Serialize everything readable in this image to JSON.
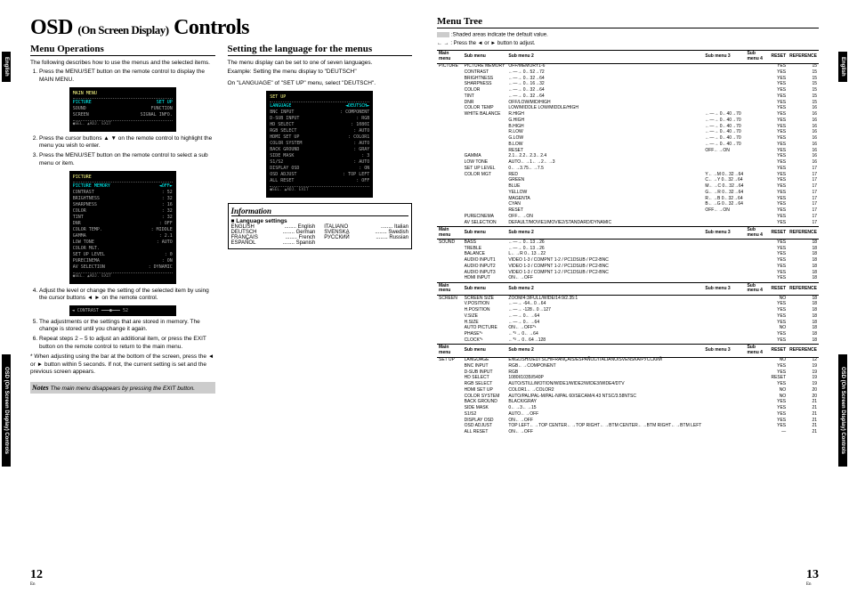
{
  "title": {
    "main": "OSD",
    "mid": "(On Screen Display)",
    "end": "Controls"
  },
  "tabs": {
    "english": "English",
    "osd": "OSD (On Screen Display) Controls"
  },
  "left": {
    "h_menuops": "Menu Operations",
    "intro": "The following describes how to use the menus and the selected items.",
    "step1": "Press the MENU/SET button on the remote control to display the MAIN MENU.",
    "osd1_title": "MAIN MENU",
    "osd1_items": [
      [
        "PICTURE",
        "SET UP"
      ],
      [
        "SOUND",
        "FUNCTION"
      ],
      [
        "SCREEN",
        "SIGNAL INFO."
      ]
    ],
    "step2": "Press the cursor buttons ▲ ▼ on the remote control to highlight the menu you wish to enter.",
    "step3": "Press the MENU/SET button on the remote control to select a sub menu or item.",
    "osd2_title": "PICTURE",
    "osd2_items": [
      [
        "PICTURE MEMORY",
        "◄OFF►"
      ],
      [
        "CONTRAST",
        ": 52"
      ],
      [
        "BRIGHTNESS",
        ": 32"
      ],
      [
        "SHARPNESS",
        ": 16"
      ],
      [
        "COLOR",
        ": 32"
      ],
      [
        "TINT",
        ": 32"
      ],
      [
        "DNR",
        ": OFF"
      ],
      [
        "COLOR TEMP.",
        ": MIDDLE"
      ],
      [
        "GAMMA",
        ": 2.1"
      ],
      [
        "LOW TONE",
        ": AUTO"
      ],
      [
        "COLOR MGT.",
        ""
      ],
      [
        "SET UP LEVEL",
        ": 0"
      ],
      [
        "PURECINEMA",
        ": ON"
      ],
      [
        "AV SELECTION",
        ": DYNAMIC"
      ]
    ],
    "step4": "Adjust the level or change the setting of the selected item by using the cursor buttons ◄ ► on the remote control.",
    "slider": "◄ CONTRAST ━━━●━━━ 52",
    "step5": "The adjustments or the settings that are stored in memory. The change is stored until you change it again.",
    "step6": "Repeat steps 2 – 5 to adjust an additional item, or press the EXIT button on the remote control to return to the main menu.",
    "note_ast": "When adjusting using the bar at the bottom of the screen, press the ◄ or ► button within 5 seconds. If not, the current setting is set and the previous screen appears.",
    "notes_label": "Notes",
    "notes_text": "The main menu disappears by pressing the EXIT button."
  },
  "mid": {
    "h_lang": "Setting the language for the menus",
    "p1": "The menu display can be set to one of seven languages.",
    "p2": "Example: Setting the menu display to \"DEUTSCH\"",
    "p3": "On \"LANGUAGE\" of \"SET UP\" menu, select \"DEUTSCH\".",
    "osd3_title": "SET UP",
    "osd3_items": [
      [
        "LANGUAGE",
        "◄DEUTSCH►"
      ],
      [
        "BNC INPUT",
        ": COMPONENT"
      ],
      [
        "D-SUB INPUT",
        ": RGB"
      ],
      [
        "HD SELECT",
        ": 1080I"
      ],
      [
        "RGB SELECT",
        ": AUTO"
      ],
      [
        "HDMI SET UP",
        ": COLOR1"
      ],
      [
        "COLOR SYSTEM",
        ": AUTO"
      ],
      [
        "BACK GROUND",
        ": GRAY"
      ],
      [
        "SIDE MASK",
        ": 3"
      ],
      [
        "S1/S2",
        ": AUTO"
      ],
      [
        "DISPLAY OSD",
        ": ON"
      ],
      [
        "OSD ADJUST",
        ": TOP LEFT"
      ],
      [
        "ALL RESET",
        ": OFF"
      ]
    ],
    "info_h": "Information",
    "info_sub": "■ Language settings",
    "langs": [
      [
        "ENGLISH",
        "English"
      ],
      [
        "DEUTSCH",
        "German"
      ],
      [
        "FRANÇAIS",
        "French"
      ],
      [
        "ESPAÑOL",
        "Spanish"
      ],
      [
        "ITALIANO",
        "Italian"
      ],
      [
        "SVENSKA",
        "Swedish"
      ],
      [
        "РУССКИЙ",
        "Russian"
      ]
    ]
  },
  "right": {
    "h_tree": "Menu Tree",
    "note1": ":Shaded areas indicate the default value.",
    "note2": "← →  : Press the ◄ or ► button to adjust.",
    "headers": [
      "Main menu",
      "Sub menu",
      "Sub menu 2",
      "Sub menu 3",
      "Sub menu 4",
      "RESET",
      "REFERENCE"
    ],
    "sections": [
      {
        "main": "PICTURE",
        "rows": [
          [
            "PICTURE MEMORY",
            "OFF/MEMORY1-6",
            "",
            "",
            "YES",
            "15"
          ],
          [
            "CONTRAST",
            "←―→  0←52→72",
            "",
            "",
            "YES",
            "15"
          ],
          [
            "BRIGHTNESS",
            "←―→  0←32→64",
            "",
            "",
            "YES",
            "15"
          ],
          [
            "SHARPNESS",
            "←―→  0←16→32",
            "",
            "",
            "YES",
            "15"
          ],
          [
            "COLOR",
            "←―→  0←32→64",
            "",
            "",
            "YES",
            "15"
          ],
          [
            "TINT",
            "←―→  0←32→64",
            "",
            "",
            "YES",
            "15"
          ],
          [
            "DNR",
            "OFF/LOW/MID/HIGH",
            "",
            "",
            "YES",
            "15"
          ],
          [
            "COLOR TEMP",
            "LOW/MIDDLE LOW/MIDDLE/HIGH",
            "",
            "",
            "YES",
            "16"
          ],
          [
            "WHITE BALANCE",
            "R.HIGH",
            "←―→  0←40→70",
            "",
            "YES",
            "16"
          ],
          [
            "",
            "G.HIGH",
            "←―→  0←40→70",
            "",
            "YES",
            "16"
          ],
          [
            "",
            "B.HIGH",
            "←―→  0←40→70",
            "",
            "YES",
            "16"
          ],
          [
            "",
            "R.LOW",
            "←―→  0←40→70",
            "",
            "YES",
            "16"
          ],
          [
            "",
            "G.LOW",
            "←―→  0←40→70",
            "",
            "YES",
            "16"
          ],
          [
            "",
            "B.LOW",
            "←―→  0←40→70",
            "",
            "YES",
            "16"
          ],
          [
            "",
            "RESET",
            "OFF←→ON",
            "",
            "YES",
            "16"
          ],
          [
            "GAMMA",
            "2.1←2.2←2.3←2.4",
            "",
            "",
            "YES",
            "16"
          ],
          [
            "LOW TONE",
            "AUTO←→1←→2←→3",
            "",
            "",
            "YES",
            "16"
          ],
          [
            "SET UP LEVEL",
            "0←→3.75←→7.5",
            "",
            "",
            "YES",
            "17"
          ],
          [
            "COLOR MGT",
            "RED",
            "Y←→M  0←32→64",
            "",
            "YES",
            "17"
          ],
          [
            "",
            "GREEN",
            "C←→Y  0←32→64",
            "",
            "YES",
            "17"
          ],
          [
            "",
            "BLUE",
            "M←→C  0←32→64",
            "",
            "YES",
            "17"
          ],
          [
            "",
            "YELLOW",
            "G←→R  0←32→64",
            "",
            "YES",
            "17"
          ],
          [
            "",
            "MAGENTA",
            "R←→B  0←32→64",
            "",
            "YES",
            "17"
          ],
          [
            "",
            "CYAN",
            "B←→G  0←32→64",
            "",
            "YES",
            "17"
          ],
          [
            "",
            "RESET",
            "OFF←→ON",
            "",
            "YES",
            "17"
          ],
          [
            "PURECINEMA",
            "OFF←→ON",
            "",
            "",
            "YES",
            "17"
          ],
          [
            "AV SELECTION",
            "DEFAULT/MOVIE1/MOVIE2/STANDARD/DYNAMIC",
            "",
            "",
            "YES",
            "17"
          ]
        ]
      },
      {
        "main": "SOUND",
        "rows": [
          [
            "BASS",
            "←―→  0←13→26",
            "",
            "",
            "YES",
            "18"
          ],
          [
            "TREBLE",
            "←―→  0←13→26",
            "",
            "",
            "YES",
            "18"
          ],
          [
            "BALANCE",
            "L←→R  0←13→22",
            "",
            "",
            "YES",
            "18"
          ],
          [
            "AUDIO INPUT1",
            "VIDEO 1-3 / COMPNT 1-2 / PC1DSUB / PC2-BNC",
            "",
            "",
            "YES",
            "18"
          ],
          [
            "AUDIO INPUT2",
            "VIDEO 1-3 / COMPNT 1-2 / PC1DSUB / PC2-BNC",
            "",
            "",
            "YES",
            "18"
          ],
          [
            "AUDIO INPUT3",
            "VIDEO 1-3 / COMPNT 1-2 / PC1DSUB / PC2-BNC",
            "",
            "",
            "YES",
            "18"
          ],
          [
            "HDMI INPUT",
            "ON←→OFF",
            "",
            "",
            "YES",
            "18"
          ]
        ]
      },
      {
        "main": "SCREEN",
        "rows": [
          [
            "SCREEN SIZE",
            "ZOOM/4:3/FULL/WIDE/14:9/2.35:1",
            "",
            "",
            "NO",
            "18"
          ],
          [
            "V.POSITION",
            "←―→  -64←0→64",
            "",
            "",
            "YES",
            "18"
          ],
          [
            "H.POSITION",
            "←―→  -128←0→127",
            "",
            "",
            "YES",
            "18"
          ],
          [
            "V.SIZE",
            "←―→  0←→64",
            "",
            "",
            "YES",
            "18"
          ],
          [
            "H.SIZE",
            "←―→  0←→64",
            "",
            "",
            "YES",
            "18"
          ],
          [
            "AUTO PICTURE",
            "ON←→OFF*¹",
            "",
            "",
            "NO",
            "18"
          ],
          [
            "PHASE*¹",
            "←*²→  0←→64",
            "",
            "",
            "YES",
            "18"
          ],
          [
            "CLOCK*¹",
            "←*²→  0←64→128",
            "",
            "",
            "YES",
            "18"
          ]
        ]
      },
      {
        "main": "SET UP",
        "rows": [
          [
            "LANGUAGE",
            "ENGLISH/DEUTSCH/FRANÇAIS/ESPAÑOL/ITALIANO/SVENSKA/РУССКИЙ",
            "",
            "",
            "NO",
            "12"
          ],
          [
            "BNC INPUT",
            "RGB←→COMPONENT",
            "",
            "",
            "YES",
            "19"
          ],
          [
            "D-SUB INPUT",
            "RGB",
            "",
            "",
            "YES",
            "19"
          ],
          [
            "HD SELECT",
            "1080I/1035I/540P",
            "",
            "",
            "RESET",
            "19"
          ],
          [
            "RGB SELECT",
            "AUTO/STILL/MOTION/WIDE1/WIDE2/WIDE3/WIDE4/DTV",
            "",
            "",
            "YES",
            "19"
          ],
          [
            "HDMI SET UP",
            "COLOR1←→COLOR2",
            "",
            "",
            "NO",
            "20"
          ],
          [
            "COLOR SYSTEM",
            "AUTO/PAL/PAL-M/PAL-N/PAL 60/SECAM/4.43 NTSC/3.58NTSC",
            "",
            "",
            "NO",
            "20"
          ],
          [
            "BACK GROUND",
            "BLACK/GRAY",
            "",
            "",
            "YES",
            "21"
          ],
          [
            "SIDE MASK",
            "0←→3←→15",
            "",
            "",
            "YES",
            "21"
          ],
          [
            "S1/S2",
            "AUTO←→OFF",
            "",
            "",
            "YES",
            "21"
          ],
          [
            "DISPLAY OSD",
            "ON←→OFF",
            "",
            "",
            "YES",
            "21"
          ],
          [
            "OSD ADJUST",
            "TOP LEFT←→TOP CENTER←→TOP RIGHT←→BTM CENTER←→BTM RIGHT←→BTM LEFT",
            "",
            "",
            "YES",
            "21"
          ],
          [
            "ALL RESET",
            "ON←→OFF",
            "",
            "",
            "—",
            "21"
          ]
        ]
      }
    ]
  },
  "pages": {
    "left": "12",
    "right": "13",
    "sub": "En"
  }
}
